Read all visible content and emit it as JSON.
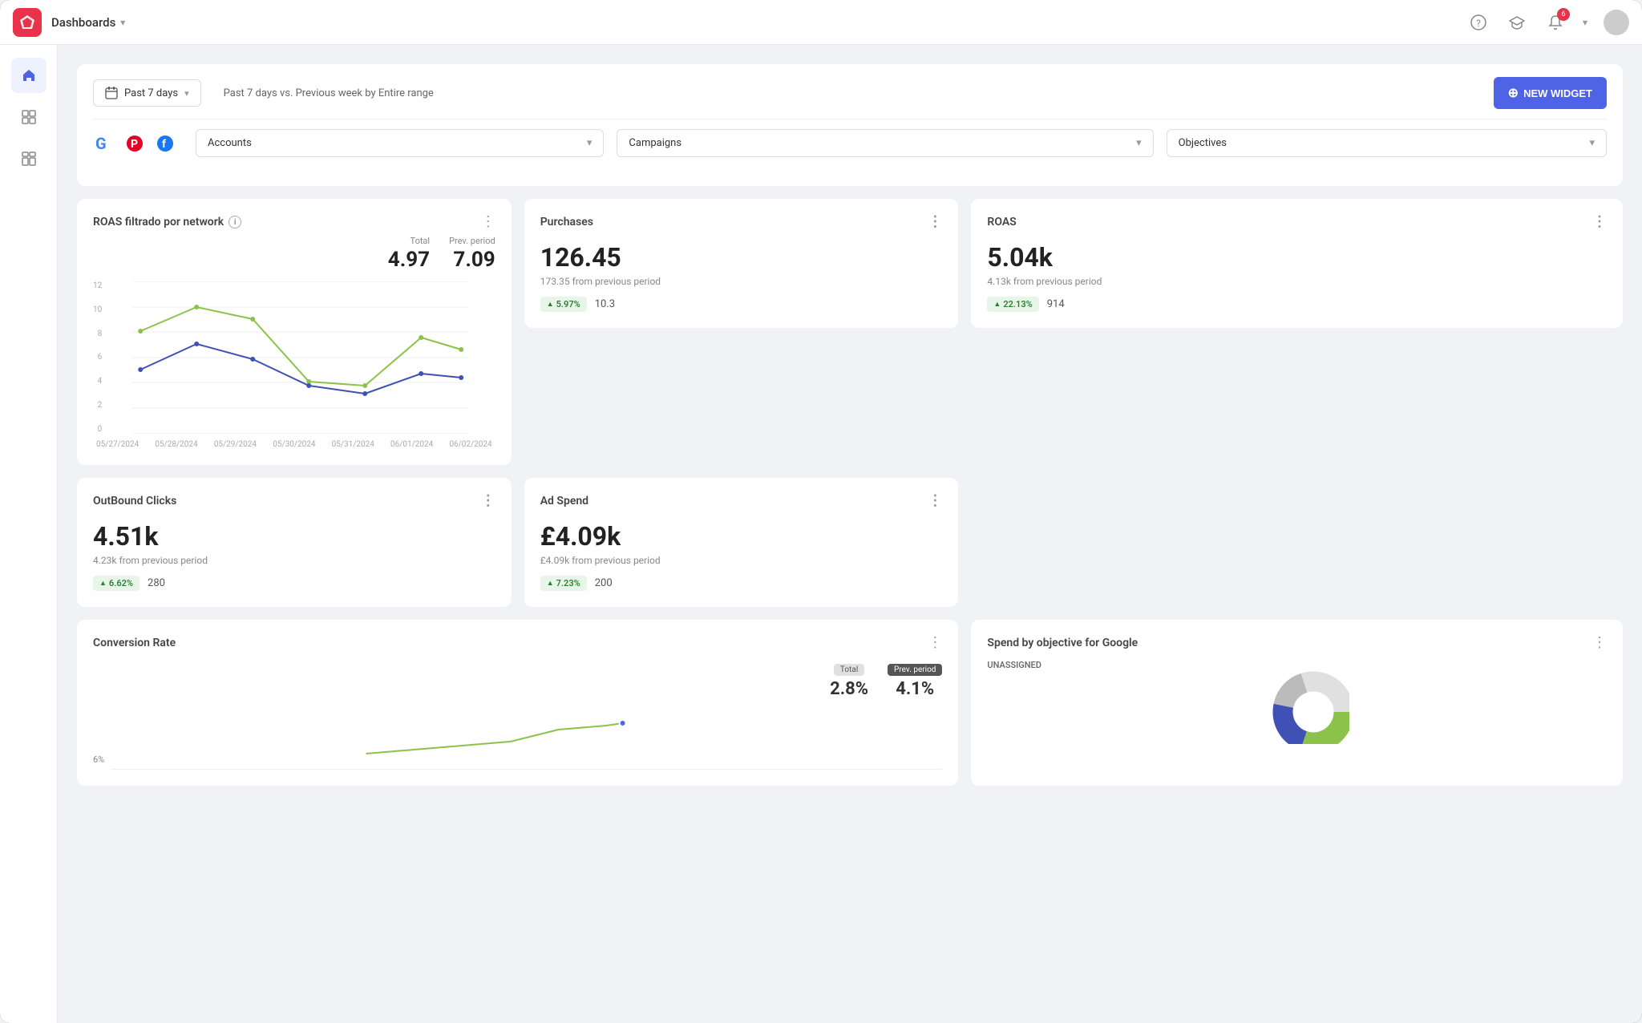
{
  "app": {
    "logo_text": "◆",
    "nav_title": "Dashboards",
    "nav_chevron": "▾",
    "new_widget_label": "NEW WIDGET"
  },
  "nav_icons": {
    "help": "?",
    "graduation": "🎓",
    "bell": "🔔",
    "badge_count": "6"
  },
  "date_bar": {
    "date_icon": "📅",
    "date_label": "Past 7 days",
    "date_chevron": "▾",
    "date_info": "Past 7 days vs. Previous week by Entire range"
  },
  "filters": {
    "accounts_label": "Accounts",
    "campaigns_label": "Campaigns",
    "objectives_label": "Objectives",
    "chevron": "▾"
  },
  "cards": {
    "purchases": {
      "title": "Purchases",
      "value": "126.45",
      "sub": "173.35 from previous period",
      "badge": "5.97%",
      "secondary": "10.3"
    },
    "roas": {
      "title": "ROAS",
      "value": "5.04k",
      "sub": "4.13k from previous period",
      "badge": "22.13%",
      "secondary": "914"
    },
    "outbound": {
      "title": "OutBound Clicks",
      "value": "4.51k",
      "sub": "4.23k from previous period",
      "badge": "6.62%",
      "secondary": "280"
    },
    "adspend": {
      "title": "Ad Spend",
      "value": "£4.09k",
      "sub": "£4.09k from previous period",
      "badge": "7.23%",
      "secondary": "200"
    }
  },
  "roas_chart": {
    "title": "ROAS filtrado por network",
    "total_label": "Total",
    "prev_label": "Prev. period",
    "total_value": "4.97",
    "prev_value": "7.09",
    "x_labels": [
      "05/27/2024",
      "05/28/2024",
      "05/29/2024",
      "05/30/2024",
      "05/31/2024",
      "06/01/2024",
      "06/02/2024"
    ],
    "y_labels": [
      "0",
      "2",
      "4",
      "6",
      "8",
      "10",
      "12"
    ],
    "line1_points": "30,155 90,120 150,135 210,165 270,170 330,145 390,140",
    "line2_points": "30,105 90,60 150,85 210,165 270,175 330,110 390,130"
  },
  "conversion_card": {
    "title": "Conversion Rate",
    "total_label": "Total",
    "prev_label": "Prev. period",
    "total_value": "2.8%",
    "prev_value": "4.1%",
    "y_label": "6%"
  },
  "spend_card": {
    "title": "Spend by objective for Google",
    "unassigned_label": "UNASSIGNED"
  }
}
